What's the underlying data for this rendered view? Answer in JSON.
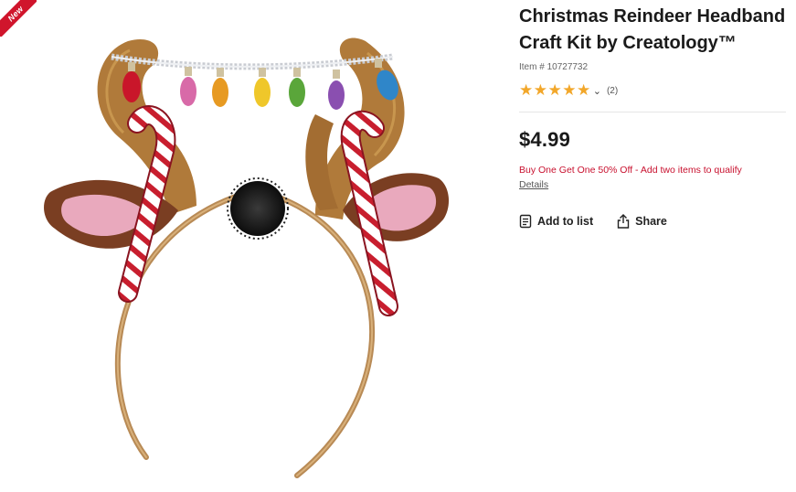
{
  "badge": {
    "label": "New",
    "color": "#d0152c"
  },
  "product": {
    "title": "Christmas Reindeer Headband Craft Kit by Creatology™",
    "item_number": "Item # 10727732",
    "rating": {
      "stars": 5,
      "review_count": "(2)"
    },
    "price": "$4.99",
    "promo": "Buy One Get One 50% Off - Add two items to qualify",
    "details_link": "Details"
  },
  "actions": {
    "add_to_list": "Add to list",
    "share": "Share"
  },
  "icons": {
    "add_to_list": "clipboard-list-icon",
    "share": "share-icon",
    "rating_toggle": "chevron-down-icon"
  },
  "colors": {
    "accent_red": "#c8102e",
    "star": "#f2a72a"
  }
}
